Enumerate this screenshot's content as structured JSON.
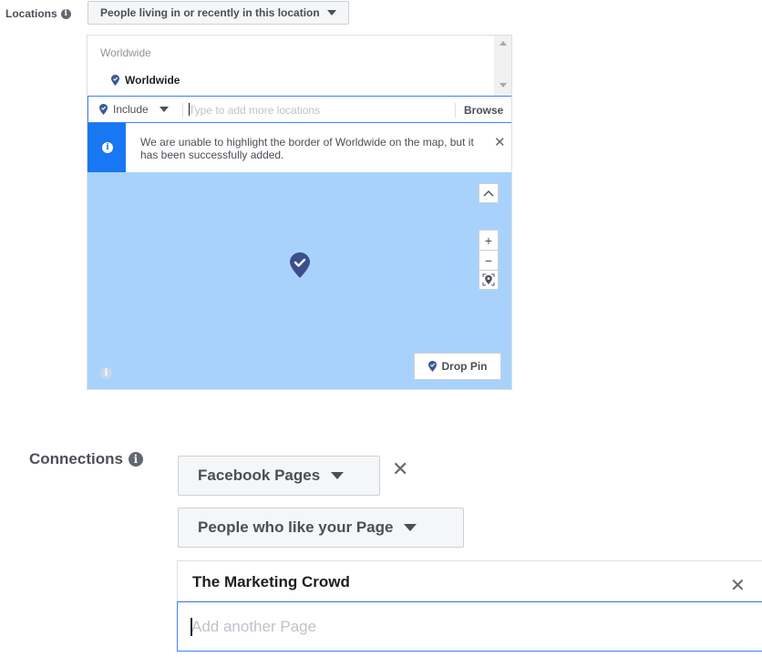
{
  "locations": {
    "label": "Locations",
    "mode_dropdown": "People living in or recently in this location",
    "group_header": "Worldwide",
    "selected_location": "Worldwide",
    "include_label": "Include",
    "search_placeholder": "Type to add more locations",
    "browse_label": "Browse",
    "notice_text": "We are unable to highlight the border of Worldwide on the map, but it has been successfully added.",
    "map": {
      "controls": [
        "collapse",
        "zoom-in",
        "zoom-out",
        "locate"
      ],
      "drop_pin_label": "Drop Pin"
    }
  },
  "connections": {
    "label": "Connections",
    "type_dropdown": "Facebook Pages",
    "audience_dropdown": "People who like your Page",
    "selected_page": "The Marketing Crowd",
    "add_placeholder": "Add another Page"
  },
  "colors": {
    "accent": "#1877f2",
    "map_water": "#a8d2fb",
    "pin": "#3b4f8c"
  },
  "icons": {
    "info": "info-icon",
    "location_pin": "location-pin-icon",
    "close": "close-icon",
    "caret": "caret-down-icon"
  }
}
